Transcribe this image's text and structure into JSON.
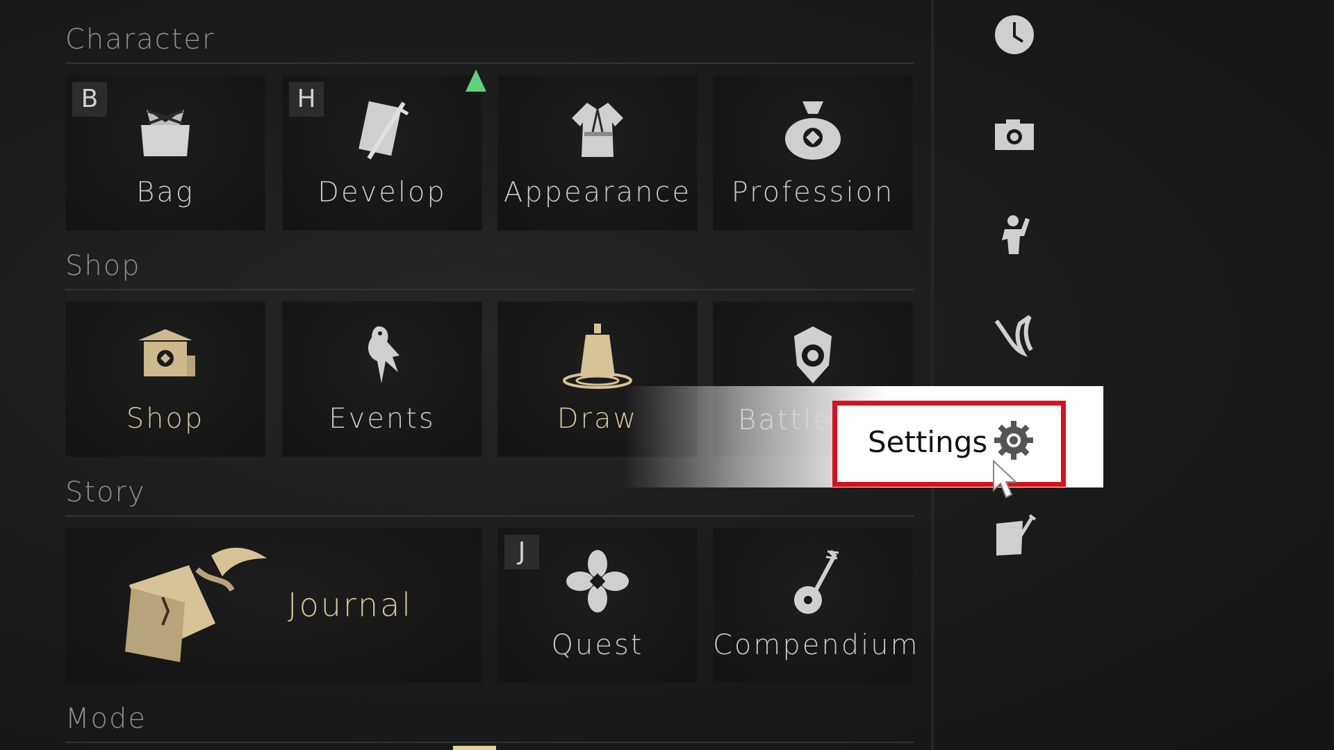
{
  "sections": {
    "character": "Character",
    "shop": "Shop",
    "story": "Story",
    "mode": "Mode"
  },
  "character_tiles": [
    {
      "label": "Bag",
      "hotkey": "B",
      "icon": "bag-icon"
    },
    {
      "label": "Develop",
      "hotkey": "H",
      "icon": "develop-icon"
    },
    {
      "label": "Appearance",
      "icon": "robe-icon"
    },
    {
      "label": "Profession",
      "icon": "profession-pouch-icon"
    }
  ],
  "shop_tiles": [
    {
      "label": "Shop",
      "icon": "shop-building-icon"
    },
    {
      "label": "Events",
      "icon": "bird-icon"
    },
    {
      "label": "Draw",
      "icon": "bell-icon"
    },
    {
      "label": "Battle",
      "icon": "battle-shield-icon"
    }
  ],
  "story_tiles": [
    {
      "label": "Journal",
      "icon": "journal-scroll-icon"
    },
    {
      "label": "Quest",
      "hotkey": "J",
      "icon": "quest-flower-icon"
    },
    {
      "label": "Compendium",
      "icon": "instrument-icon"
    }
  ],
  "side_icons": [
    "clock-icon",
    "camera-icon",
    "emote-figure-icon",
    "claw-icon",
    "music-sheet-icon"
  ],
  "settings": {
    "label": "Settings",
    "icon": "gear-icon"
  },
  "colors": {
    "highlight": "#d6121e",
    "gold_text": "#d6c496",
    "notify": "#5fd17a"
  }
}
